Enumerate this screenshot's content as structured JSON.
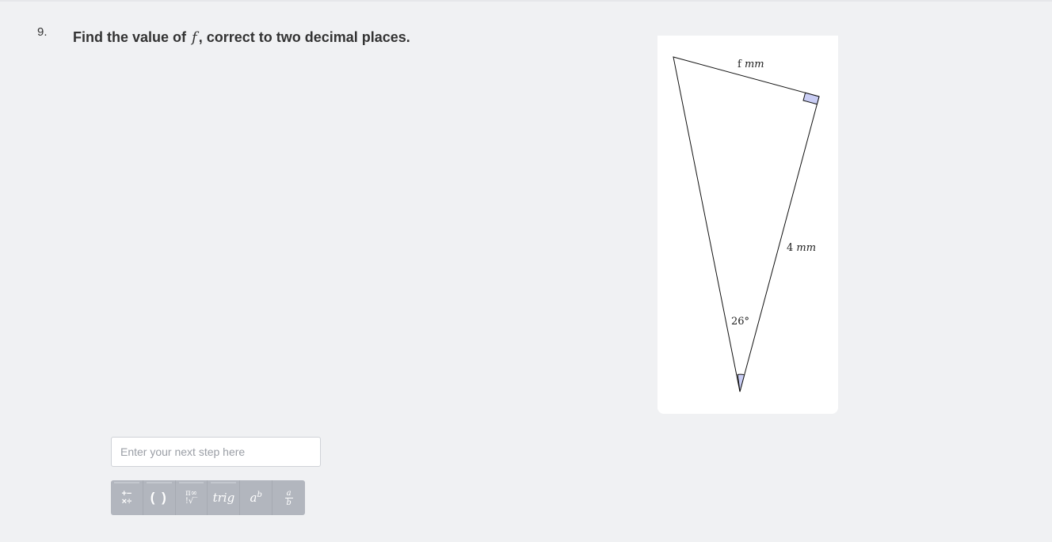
{
  "question": {
    "number": "9.",
    "prompt_before": "Find the value of",
    "variable": "f",
    "prompt_after": ", correct to two decimal places."
  },
  "figure": {
    "top_label": "f",
    "top_unit": "mm",
    "side_label": "4",
    "side_unit": "mm",
    "angle_label": "26°",
    "shade_color": "#c9cdf4"
  },
  "answer": {
    "placeholder": "Enter your next step here"
  },
  "toolbar": {
    "ops_top": "+−",
    "ops_bottom": "×÷",
    "parens": "( )",
    "special_top": "π∞",
    "special_bottom": "!√‾",
    "trig": "trig",
    "power_base": "a",
    "power_exp": "b",
    "frac_num": "a",
    "frac_den": "b"
  }
}
